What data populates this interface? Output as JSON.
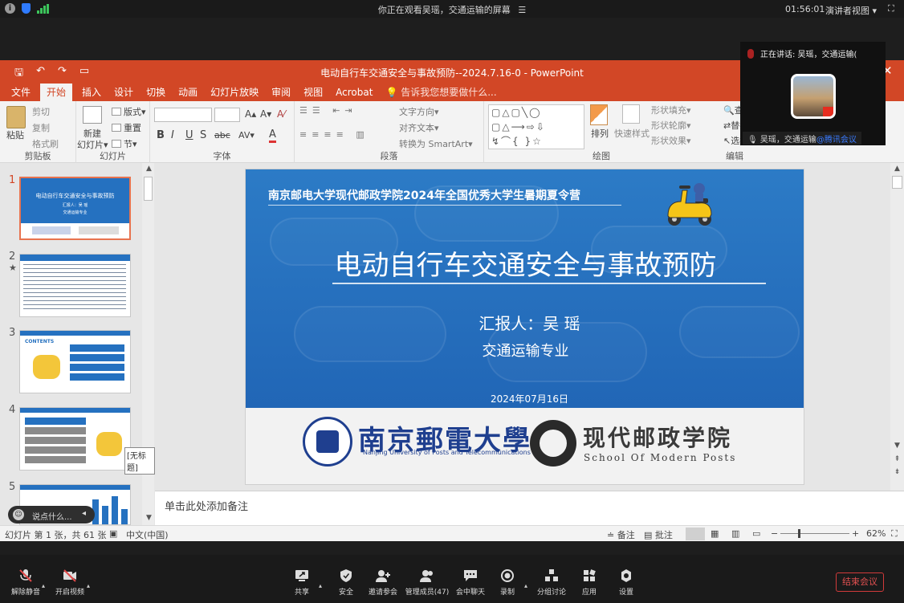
{
  "system_bar": {
    "sharing_notice": "你正在观看吴瑶，交通运输的屏幕",
    "menu_glyph": "☰",
    "time": "01:56:01",
    "view_mode": "演讲者视图",
    "view_mode_caret": "▾",
    "fullscreen_glyph": "⛶",
    "info_glyph": "i"
  },
  "window": {
    "title": "电动自行车交通安全与事故预防--2024.7.16-0 - PowerPoint",
    "quick_access": [
      "🖫",
      "↶",
      "↷",
      "▭"
    ],
    "close_glyph": "✕"
  },
  "ribbon_tabs": [
    "文件",
    "开始",
    "插入",
    "设计",
    "切换",
    "动画",
    "幻灯片放映",
    "审阅",
    "视图",
    "Acrobat"
  ],
  "active_tab": "开始",
  "tell_me": "💡 告诉我您想要做什么...",
  "ribbon": {
    "clipboard": {
      "label": "剪贴板",
      "paste": "粘贴",
      "cut": "剪切",
      "copy": "复制",
      "format_painter": "格式刷"
    },
    "slides": {
      "label": "幻灯片",
      "new_slide": "新建",
      "new_slide2": "幻灯片▾",
      "layout": "版式▾",
      "reset": "重置",
      "section": "节▾"
    },
    "font": {
      "label": "字体",
      "bold": "B",
      "italic": "I",
      "underline": "U",
      "strike": "S",
      "shadow": "abc",
      "spacing": "AV▾",
      "grow": "A▴",
      "shrink": "A▾",
      "clear": "A⁄",
      "color": "A"
    },
    "paragraph": {
      "label": "段落",
      "text_direction": "文字方向▾",
      "align_text": "对齐文本▾",
      "smartart": "转换为 SmartArt▾"
    },
    "drawing": {
      "label": "绘图",
      "shapes": "▢△▢╲◯\n▢△⟶⇨⇩\n↯⌒{ }☆",
      "arrange": "排列",
      "quick_styles": "快速样式",
      "fill": "形状填充▾",
      "outline": "形状轮廓▾",
      "effects": "形状效果▾"
    },
    "editing": {
      "label": "编辑",
      "find": "查找",
      "replace": "替换",
      "select": "选择"
    }
  },
  "thumbnail_panel": {
    "slide_numbers": [
      "1",
      "2",
      "3",
      "4",
      "5"
    ],
    "star": "★",
    "tooltip": "[无标题]",
    "thumb_texts": {
      "s1_title": "电动自行车交通安全与事故预防",
      "s1_reporter": "汇报人：吴 瑶",
      "s1_major": "交通运输专业",
      "s3_header": "CONTENTS",
      "s4_nums": [
        "01",
        "02",
        "03",
        "04",
        "05"
      ]
    }
  },
  "slide": {
    "camp_title": "南京邮电大学现代邮政学院2024年全国优秀大学生暑期夏令营",
    "main_title": "电动自行车交通安全与事故预防",
    "reporter": "汇报人：吴 瑶",
    "major": "交通运输专业",
    "date": "2024年07月16日",
    "university_cn": "南京郵電大學",
    "university_en": "Nanjing University of Posts and Telecommunications",
    "school_cn": "现代邮政学院",
    "school_en": "School Of Modern Posts"
  },
  "notes_placeholder": "单击此处添加备注",
  "status_bar": {
    "slide_info": "幻灯片 第 1 张，共 61 张",
    "language": "中文(中国)",
    "notes": "≐ 备注",
    "comments": "▤ 批注",
    "zoom": "62%",
    "zoom_minus": "−",
    "zoom_plus": "+"
  },
  "chat_input": {
    "placeholder": "说点什么...",
    "emoji": "☺",
    "collapse": "◂"
  },
  "speaker_panel": {
    "speaking_label": "正在讲话:  吴瑶，交通运输(",
    "name": "吴瑶，交通运输",
    "source": "@腾讯会议"
  },
  "meeting_toolbar": {
    "unmute": "解除静音",
    "video": "开启视频",
    "share": "共享",
    "security": "安全",
    "invite": "邀请参会",
    "members": "管理成员(47)",
    "chat": "会中聊天",
    "record": "录制",
    "breakout": "分组讨论",
    "apps": "应用",
    "settings": "设置",
    "end": "结束会议",
    "caret": "▴"
  },
  "colors": {
    "ppt_accent": "#d24726",
    "slide_blue": "#2571c0",
    "meeting_end": "#e05050",
    "link_blue": "#3a7bff"
  }
}
